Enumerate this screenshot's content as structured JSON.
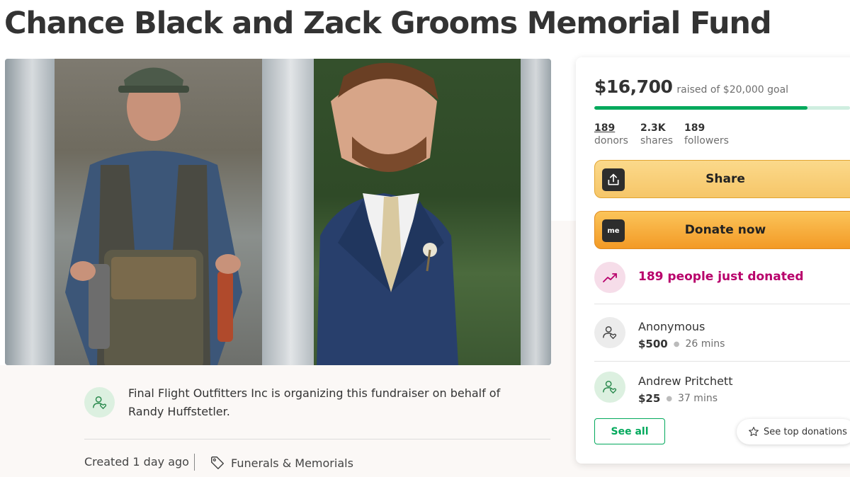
{
  "page": {
    "title": "Chance Black and Zack Grooms Memorial Fund"
  },
  "organizer": {
    "text": "Final Flight Outfitters Inc is organizing this fundraiser on behalf of Randy Huffstetler.",
    "icon": "user-heart-icon"
  },
  "meta": {
    "created": "Created 1 day ago",
    "category": "Funerals & Memorials",
    "category_icon": "tag-icon"
  },
  "donation_card": {
    "raised_amount": "$16,700",
    "goal_text": "raised of $20,000 goal",
    "progress_fraction": 0.835,
    "stats": {
      "donors_num": "189",
      "donors_label": "donors",
      "shares_num": "2.3K",
      "shares_label": "shares",
      "followers_num": "189",
      "followers_label": "followers"
    },
    "share_label": "Share",
    "share_icon": "share-upload-icon",
    "donate_label": "Donate now",
    "donate_icon_text": "me",
    "trend_text": "189 people just donated",
    "trend_icon": "trending-up-icon",
    "donations": [
      {
        "name": "Anonymous",
        "amount": "$500",
        "time": "26 mins",
        "icon": "user-heart-icon"
      },
      {
        "name": "Andrew Pritchett",
        "amount": "$25",
        "time": "37 mins",
        "icon": "user-heart-icon"
      }
    ],
    "see_all_label": "See all",
    "see_top_label": "See top donations",
    "see_top_icon": "star-outline-icon"
  },
  "colors": {
    "accent_green": "#02a95c",
    "trend_magenta": "#b8006b",
    "share_yellow": "#f6c668",
    "donate_orange": "#f39a25"
  }
}
